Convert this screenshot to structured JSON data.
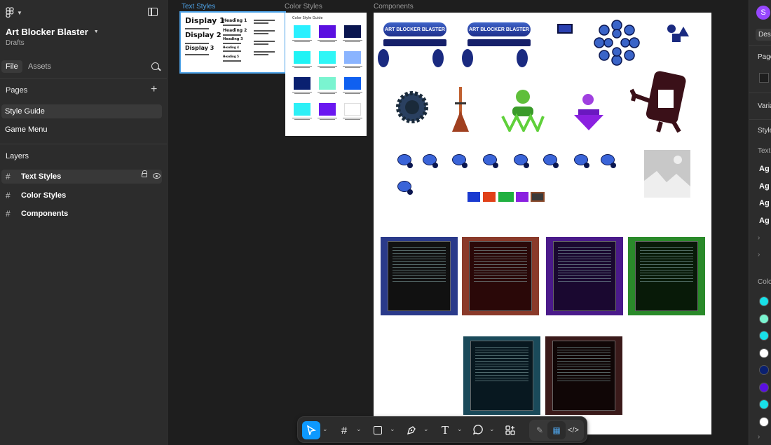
{
  "project": {
    "title": "Art Blocker Blaster",
    "location": "Drafts"
  },
  "left_tabs": [
    "File",
    "Assets"
  ],
  "pages": {
    "title": "Pages",
    "items": [
      "Style Guide",
      "Game Menu"
    ]
  },
  "layers": {
    "title": "Layers",
    "items": [
      "Text Styles",
      "Color Styles",
      "Components"
    ]
  },
  "frames": {
    "text_styles": "Text Styles",
    "color_styles": "Color Styles",
    "components": "Components"
  },
  "text_styles": {
    "displays": [
      "Display 1",
      "Display 2",
      "Display 3"
    ],
    "headings": [
      "Heading 1",
      "Heading 2",
      "Heading 3",
      "Heading 4",
      "Heading 5"
    ]
  },
  "color_styles": {
    "title": "Color Style Guide",
    "swatches": [
      "#2af0ff",
      "#5a10e0",
      "#0a1650",
      "#1ff3f5",
      "#2ff6f6",
      "#8ab4ff",
      "#0a2070",
      "#7af4d0",
      "#1060f0",
      "#2df0f6",
      "#6a18f0",
      "#ffffff"
    ]
  },
  "components": {
    "game_title": "ART BLOCKER BLASTER"
  },
  "right_panel": {
    "avatar": "S",
    "tab": "Desi",
    "sections": [
      "Page",
      "Varia",
      "Style",
      "Text"
    ],
    "text_samples": [
      "Ag",
      "Ag",
      "Ag",
      "Ag"
    ],
    "color_title": "Colo",
    "colors": [
      "#18e0e8",
      "#7af4d0",
      "#18e0e8",
      "#ffffff",
      "#0a2070",
      "#5a10e0",
      "#18e0e8",
      "#ffffff"
    ]
  }
}
